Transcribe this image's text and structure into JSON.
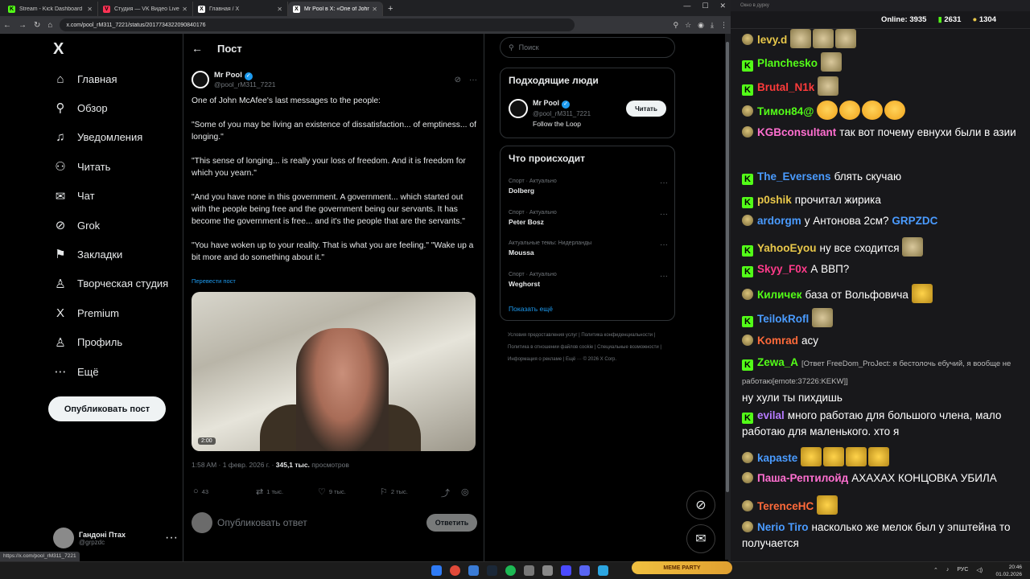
{
  "browser": {
    "tabs": [
      {
        "label": "Stream - Kick Dashboard",
        "fav_color": "#53fc18",
        "fav_letter": "K"
      },
      {
        "label": "Студия — VK Видео Live",
        "fav_color": "#ff3355",
        "fav_letter": "V"
      },
      {
        "label": "Главная / X",
        "fav_color": "#ffffff",
        "fav_letter": "X"
      },
      {
        "label": "Mr Pool в X: «One of John McAfee's…",
        "fav_color": "#ffffff",
        "fav_letter": "X"
      }
    ],
    "url": "x.com/pool_rM311_7221/status/2017734322090840176",
    "status_url": "https://x.com/pool_rM311_7221"
  },
  "nav": {
    "items": [
      {
        "label": "Главная",
        "icon": "home-icon",
        "glyph": "⌂"
      },
      {
        "label": "Обзор",
        "icon": "search-icon",
        "glyph": "⚲"
      },
      {
        "label": "Уведомления",
        "icon": "bell-icon",
        "glyph": "♫"
      },
      {
        "label": "Читать",
        "icon": "add-user-icon",
        "glyph": "⚇"
      },
      {
        "label": "Чат",
        "icon": "mail-icon",
        "glyph": "✉"
      },
      {
        "label": "Grok",
        "icon": "grok-icon",
        "glyph": "⊘"
      },
      {
        "label": "Закладки",
        "icon": "bookmark-icon",
        "glyph": "⚑"
      },
      {
        "label": "Творческая студия",
        "icon": "studio-icon",
        "glyph": "♙"
      },
      {
        "label": "Premium",
        "icon": "x-premium-icon",
        "glyph": "X"
      },
      {
        "label": "Профиль",
        "icon": "profile-icon",
        "glyph": "♙"
      },
      {
        "label": "Ещё",
        "icon": "more-icon",
        "glyph": "⋯"
      }
    ],
    "post_button": "Опубликовать пост",
    "me_name": "Гандоні Птах",
    "me_handle": "@grpzdc"
  },
  "post": {
    "header": "Пост",
    "author_name": "Mr Pool",
    "author_handle": "@pool_rM311_7221",
    "paragraphs": [
      "One of John McAfee's last messages to the people:",
      "\"Some of you may be living an existence of dissatisfaction... of emptiness... of longing.\"",
      "\"This sense of longing... is really your loss of freedom. And it is freedom for which you yearn.\"",
      "\"And you have none in this government. A government... which started out with the people being free and the government being our servants. It has become the government is free... and it's the people that are the servants.\"",
      "\"You have woken up to your reality. That is what you are feeling.\"  \"Wake up a bit more and do something about it.\""
    ],
    "translate": "Перевести пост",
    "video_duration": "2:00",
    "time": "1:58 AM · 1 февр. 2026 г. · ",
    "views": "345,1 тыс.",
    "views_label": " просмотров",
    "replies": "43",
    "reposts": "1 тыс.",
    "likes": "9 тыс.",
    "bookmarks": "2 тыс.",
    "reply_placeholder": "Опубликовать ответ",
    "reply_button": "Ответить"
  },
  "right": {
    "search_placeholder": "Поиск",
    "people_title": "Подходящие люди",
    "person_name": "Mr Pool",
    "person_handle": "@pool_rM311_7221",
    "person_bio": "Follow the Loop",
    "follow_label": "Читать",
    "trends_title": "Что происходит",
    "trends": [
      {
        "cat": "Спорт · Актуально",
        "name": "Dolberg"
      },
      {
        "cat": "Спорт · Актуально",
        "name": "Peter Bosz"
      },
      {
        "cat": "Актуальные темы: Нидерланды",
        "name": "Moussa"
      },
      {
        "cat": "Спорт · Актуально",
        "name": "Weghorst"
      }
    ],
    "show_more": "Показать ещё",
    "footer": "Условия предоставления услуг  |  Политика конфиденциальности  |  Политика в отношении файлов cookie  |  Специальные возможности  |  Информация о рекламе  |  Ещё ···  © 2026 X Corp."
  },
  "chat": {
    "window_title": "Окно в дурку",
    "online_label": "Online:",
    "online": "3935",
    "kick_count": "2631",
    "other_count": "1304",
    "messages": [
      {
        "badge": "cr",
        "user": "levy.d",
        "color": "#e9c84a",
        "text": "",
        "emotes": "ppp"
      },
      {
        "badge": "k",
        "user": "Planchesko",
        "color": "#53fc18",
        "text": "",
        "emotes": "p"
      },
      {
        "badge": "k",
        "user": "Brutal_N1k",
        "color": "#ff3b3b",
        "text": "",
        "emotes": "p"
      },
      {
        "badge": "cr",
        "user": "Тимон84@",
        "color": "#53fc18",
        "text": "",
        "emotes": "llll"
      },
      {
        "badge": "cr",
        "user": "KGBconsultant",
        "color": "#ff6fd0",
        "text": "так вот почему евнухи были в азии",
        "emotes": ""
      },
      {
        "badge": "k",
        "user": "The_Eversens",
        "color": "#4a9bff",
        "text": "блять скучаю",
        "emotes": ""
      },
      {
        "badge": "k",
        "user": "p0shik",
        "color": "#e9c84a",
        "text": "прочитал жирика",
        "emotes": ""
      },
      {
        "badge": "cr",
        "user": "ardorgm",
        "color": "#4a9bff",
        "text": "у Антонова 2см?",
        "emotes": "",
        "mention": "GRPZDC"
      },
      {
        "badge": "k",
        "user": "YahooEyou",
        "color": "#e9c84a",
        "text": "ну все сходится",
        "emotes": "p"
      },
      {
        "badge": "k",
        "user": "Skyy_F0x",
        "color": "#ff3b8a",
        "text": "А ВВП?",
        "emotes": ""
      },
      {
        "badge": "cr",
        "user": "Киличек",
        "color": "#53fc18",
        "text": "база от Вольфовича",
        "emotes": "f"
      },
      {
        "badge": "k",
        "user": "TeilokRofl",
        "color": "#4a9bff",
        "text": "",
        "emotes": "p"
      },
      {
        "badge": "cr",
        "user": "Komrad",
        "color": "#ff6a3a",
        "text": "асу",
        "emotes": ""
      },
      {
        "badge": "k",
        "user": "Zewa_A",
        "color": "#53fc18",
        "text": "ну хули ты пихдишь",
        "emotes": "",
        "reply": "[Ответ FreeDom_ProJect: я бестолочь ебучий, я вообще не работаю[emote:37226:KEKW]]"
      },
      {
        "badge": "k",
        "user": "evilal",
        "color": "#b67bff",
        "text": "много работаю для большого члена, мало работаю для маленького. хто я",
        "emotes": ""
      },
      {
        "badge": "cr",
        "user": "kapaste",
        "color": "#4a9bff",
        "text": "",
        "emotes": "ffff"
      },
      {
        "badge": "cr",
        "user": "Паша-Рептилойд",
        "color": "#ff6fd0",
        "text": "АХАХАХ КОНЦОВКА УБИЛА",
        "emotes": ""
      },
      {
        "badge": "cr",
        "user": "TerenceHC",
        "color": "#ff6a3a",
        "text": "",
        "emotes": "f"
      },
      {
        "badge": "cr",
        "user": "Nerio Tiro",
        "color": "#4a9bff",
        "text": "насколько же мелок был у эпштейна то получается",
        "emotes": ""
      }
    ]
  },
  "taskbar": {
    "time": "20:46",
    "date": "01.02.2026",
    "lang": "РУС",
    "meme": "MEME PARTY"
  },
  "colors": {
    "accent": "#1d9bf0",
    "kick": "#53fc18"
  }
}
